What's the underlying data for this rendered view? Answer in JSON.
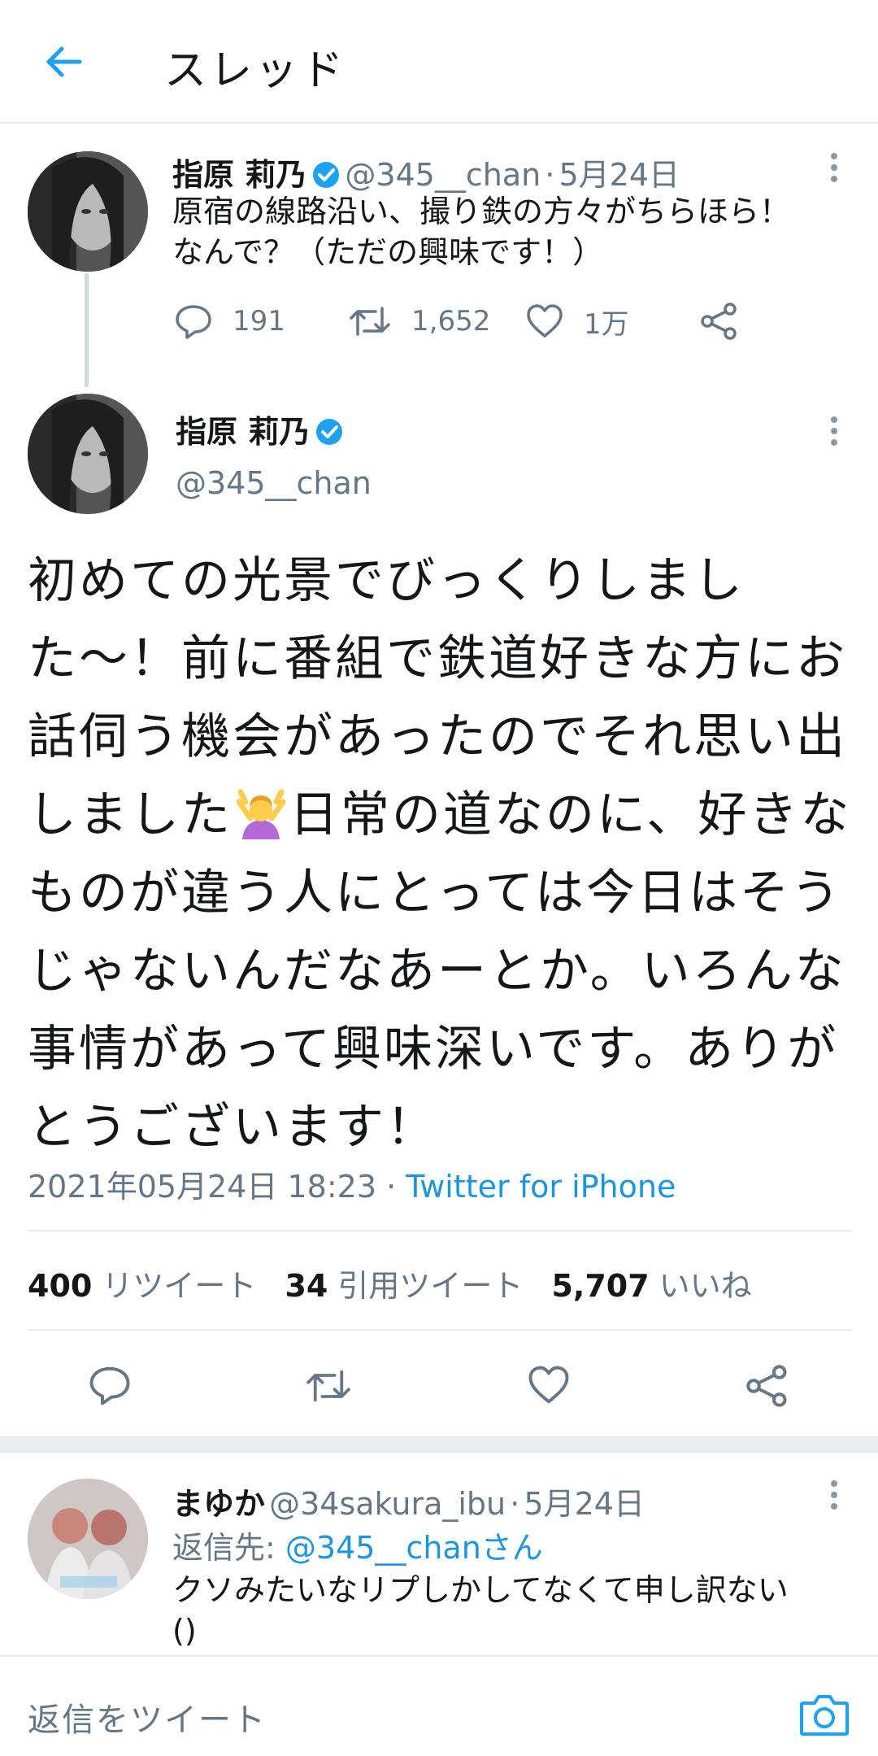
{
  "header": {
    "title": "スレッド"
  },
  "tweet1": {
    "name": "指原 莉乃",
    "handle": "@345__chan",
    "separator": "·",
    "date": "5月24日",
    "text_line1": "原宿の線路沿い、撮り鉄の方々がちらほら！",
    "text_line2": "なんで？（ただの興味です！）",
    "replies": "191",
    "retweets": "1,652",
    "likes": "1万"
  },
  "main_tweet": {
    "name": "指原 莉乃",
    "handle": "@345__chan",
    "text_before_emoji": "初めての光景でびっくりしました〜！前に番組で鉄道好きな方にお話伺う機会があったのでそれ思い出しました",
    "text_after_emoji": "日常の道なのに、好きなものが違う人にとっては今日はそうじゃないんだなあーとか。いろんな事情があって興味深いです。ありがとうございます！",
    "emoji": "raising-hands-emoji",
    "timestamp": "2021年05月24日 18:23",
    "separator": "·",
    "source": "Twitter for iPhone",
    "stats": {
      "retweets_count": "400",
      "retweets_label": "リツイート",
      "quotes_count": "34",
      "quotes_label": "引用ツイート",
      "likes_count": "5,707",
      "likes_label": "いいね"
    }
  },
  "reply_tweet": {
    "name": "まゆか",
    "handle": "@34sakura_ibu",
    "separator": "·",
    "date": "5月24日",
    "reply_to_label": "返信先:",
    "reply_to_handle": "@345__chanさん",
    "text_line1": "クソみたいなリプしかしてなくて申し訳ない",
    "text_line2": "()"
  },
  "compose": {
    "placeholder": "返信をツイート"
  },
  "colors": {
    "accent": "#1da1f2",
    "link": "#1b95e0",
    "secondary_text": "#657786",
    "divider": "#e6ecf0"
  }
}
